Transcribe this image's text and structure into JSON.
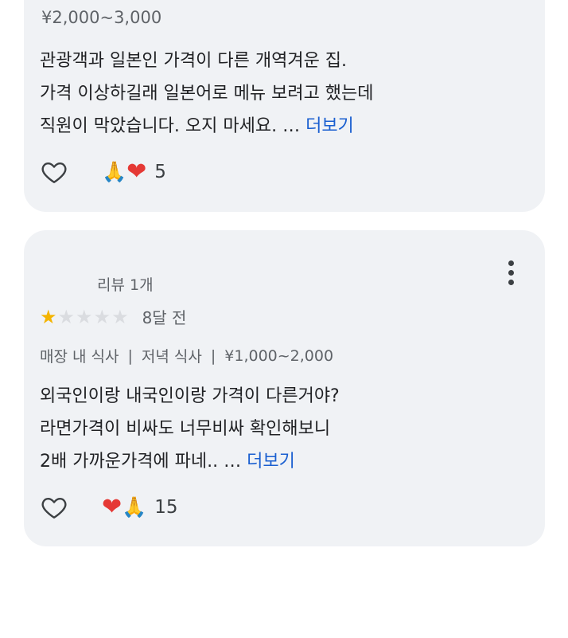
{
  "reviews": [
    {
      "price": "¥2,000~3,000",
      "text_lines": "관광객과 일본인 가격이 다른 개역겨운 집.\n가격 이상하길래 일본어로 메뉴 보려고 했는데\n직원이 막았습니다. 오지 마세요. … ",
      "more_label": "더보기",
      "reaction_emojis": [
        "🙏",
        "❤"
      ],
      "reaction_count": "5"
    },
    {
      "reviewer_meta": "리뷰 1개",
      "rating": 1,
      "rating_max": 5,
      "time_ago": "8달 전",
      "meta": [
        "매장 내 식사",
        "저녁 식사",
        "¥1,000~2,000"
      ],
      "text_lines": "외국인이랑 내국인이랑 가격이 다른거야?\n라면가격이 비싸도 너무비싸 확인해보니\n2배 가까운가격에 파네.. … ",
      "more_label": "더보기",
      "reaction_emojis": [
        "❤",
        "🙏"
      ],
      "reaction_count": "15"
    }
  ],
  "icons": {
    "like": "heart-outline-icon",
    "menu": "more-vert-icon",
    "star": "star-icon"
  },
  "colors": {
    "card_bg": "#f0f2f5",
    "link": "#1a5fd0",
    "star_filled": "#f4b400",
    "star_empty": "#dadce0",
    "heart_emoji": "#e53935"
  }
}
